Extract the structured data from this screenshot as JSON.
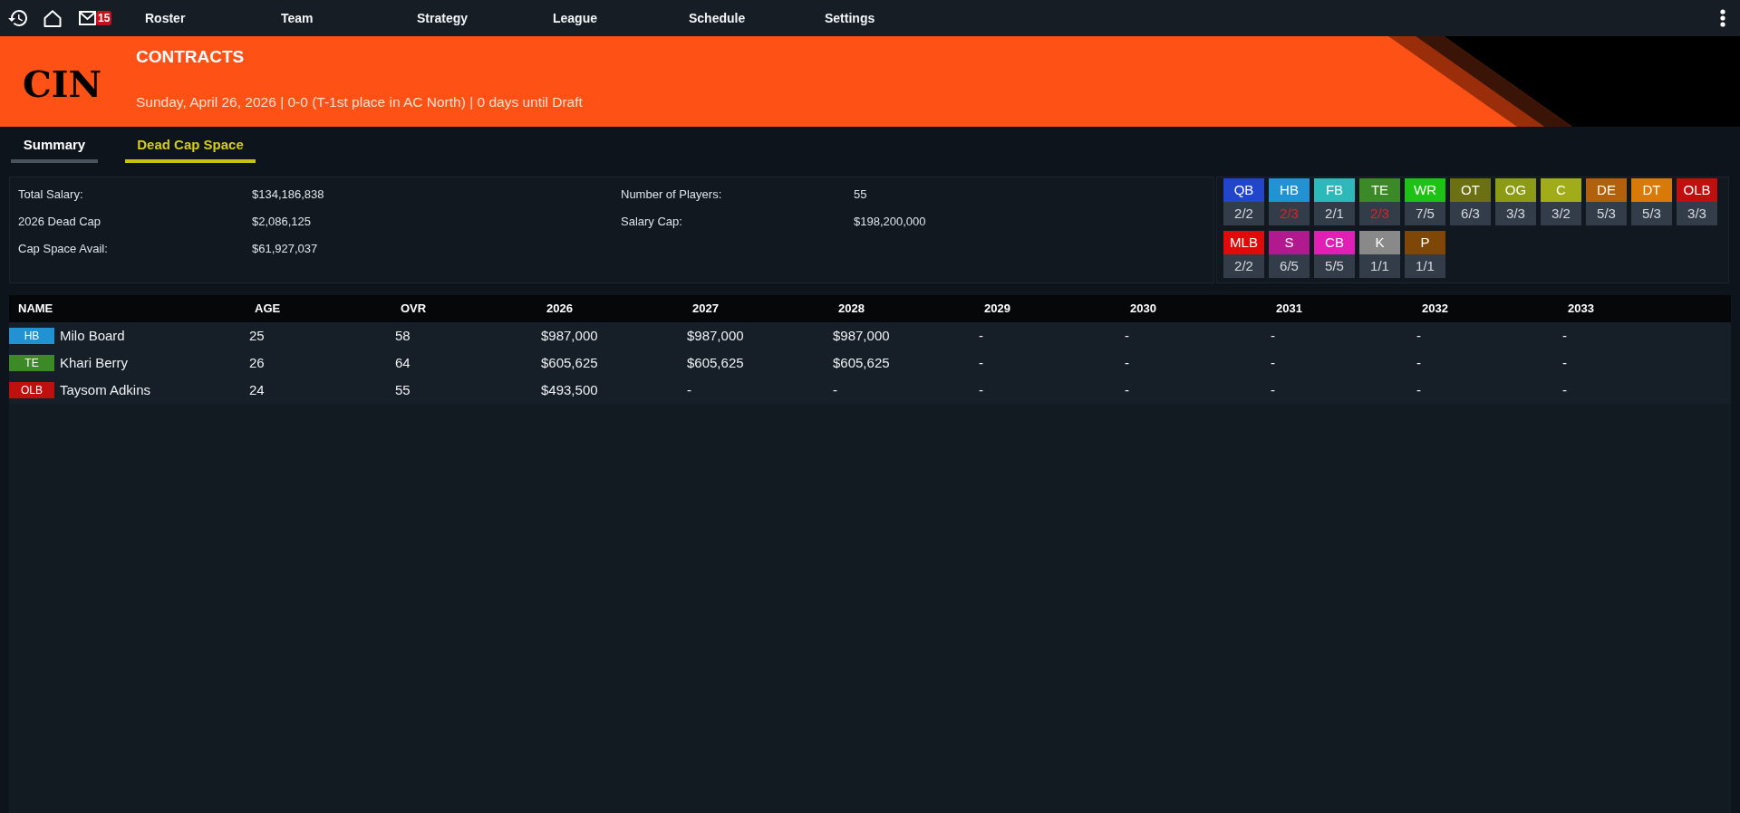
{
  "top_bar": {
    "unread_count": "15",
    "menu": [
      "Roster",
      "Team",
      "Strategy",
      "League",
      "Schedule",
      "Settings"
    ]
  },
  "header": {
    "team_logo": "CIN",
    "title": "CONTRACTS",
    "subtitle": "Sunday, April 26, 2026 | 0-0 (T-1st place in AC North) | 0 days until Draft"
  },
  "tabs": [
    {
      "label": "Summary",
      "selected": false
    },
    {
      "label": "Dead Cap Space",
      "selected": true
    }
  ],
  "summary": {
    "columns": [
      [
        {
          "label": "Total Salary:",
          "value": "$134,186,838"
        },
        {
          "label": "2026 Dead Cap",
          "value": "$2,086,125"
        },
        {
          "label": "Cap Space Avail:",
          "value": "$61,927,037"
        }
      ],
      [
        {
          "label": "Number of Players:",
          "value": "55"
        },
        {
          "label": "Salary Cap:",
          "value": "$198,200,000"
        }
      ]
    ],
    "positions": [
      {
        "label": "QB",
        "color": "#2146cc",
        "count": "2/2",
        "short": false
      },
      {
        "label": "HB",
        "color": "#2192d2",
        "count": "2/3",
        "short": true
      },
      {
        "label": "FB",
        "color": "#2fb8b9",
        "count": "2/1",
        "short": false
      },
      {
        "label": "TE",
        "color": "#3b8a27",
        "count": "2/3",
        "short": true
      },
      {
        "label": "WR",
        "color": "#1ec214",
        "count": "7/5",
        "short": false
      },
      {
        "label": "OT",
        "color": "#6b7012",
        "count": "6/3",
        "short": false
      },
      {
        "label": "OG",
        "color": "#8b9b14",
        "count": "3/3",
        "short": false
      },
      {
        "label": "C",
        "color": "#a1ad18",
        "count": "3/2",
        "short": false
      },
      {
        "label": "DE",
        "color": "#b06109",
        "count": "5/3",
        "short": false
      },
      {
        "label": "DT",
        "color": "#d97a08",
        "count": "5/3",
        "short": false
      },
      {
        "label": "OLB",
        "color": "#c00f0f",
        "count": "3/3",
        "short": false
      },
      {
        "label": "MLB",
        "color": "#e10a0a",
        "count": "2/2",
        "short": false
      },
      {
        "label": "S",
        "color": "#b11a8e",
        "count": "6/5",
        "short": false
      },
      {
        "label": "CB",
        "color": "#e01fb4",
        "count": "5/5",
        "short": false
      },
      {
        "label": "K",
        "color": "#898989",
        "count": "1/1",
        "short": false
      },
      {
        "label": "P",
        "color": "#7e4707",
        "count": "1/1",
        "short": false
      }
    ]
  },
  "table": {
    "columns": [
      "NAME",
      "AGE",
      "OVR",
      "2026",
      "2027",
      "2028",
      "2029",
      "2030",
      "2031",
      "2032",
      "2033"
    ],
    "rows": [
      {
        "cells": [
          {
            "position": "HB",
            "color": "#2192d2",
            "name": "Milo Board"
          },
          "25",
          "58",
          "$987,000",
          "$987,000",
          "$987,000",
          "-",
          "-",
          "-",
          "-",
          "-"
        ]
      },
      {
        "cells": [
          {
            "position": "TE",
            "color": "#3b8a27",
            "name": "Khari Berry"
          },
          "26",
          "64",
          "$605,625",
          "$605,625",
          "$605,625",
          "-",
          "-",
          "-",
          "-",
          "-"
        ]
      },
      {
        "cells": [
          {
            "position": "OLB",
            "color": "#c00f0f",
            "name": "Taysom Adkins"
          },
          "24",
          "55",
          "$493,500",
          "-",
          "-",
          "-",
          "-",
          "-",
          "-",
          "-"
        ]
      }
    ]
  }
}
